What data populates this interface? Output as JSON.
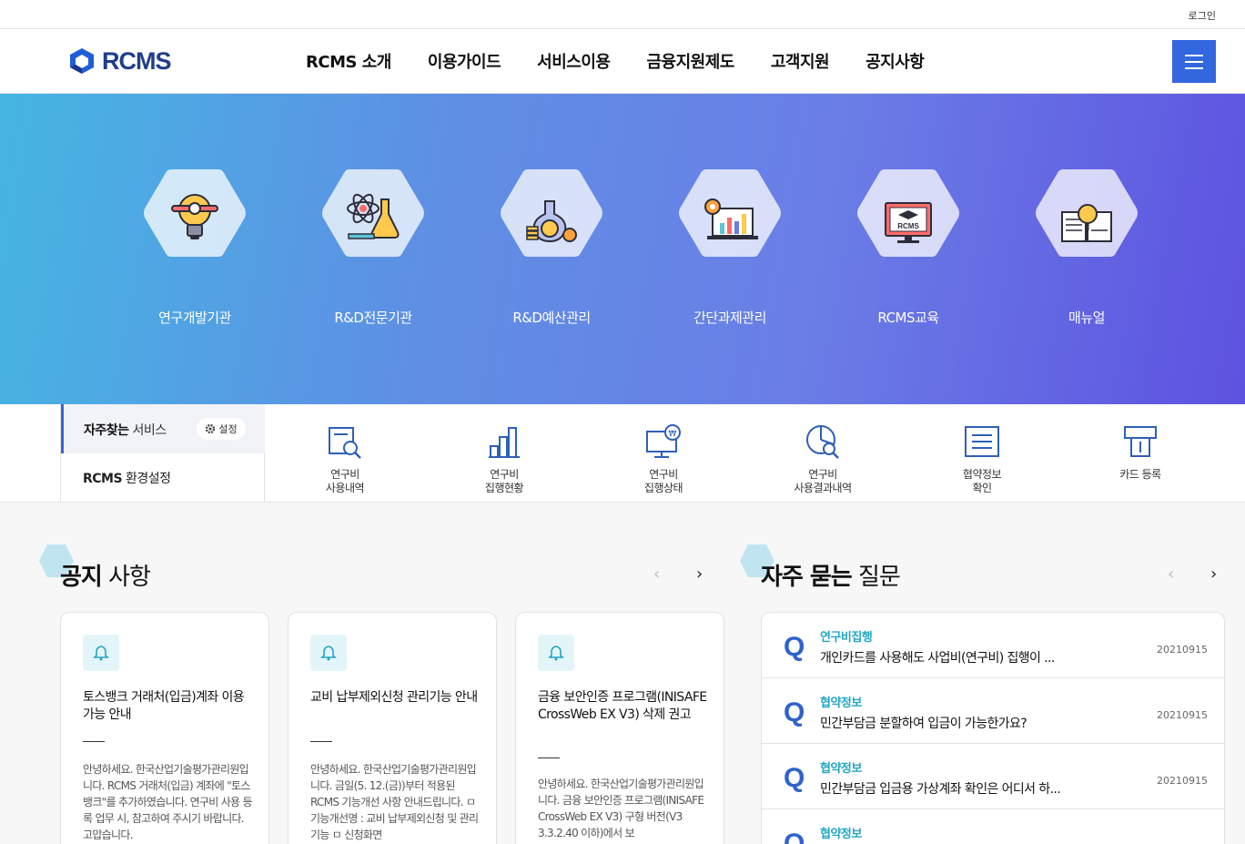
{
  "utility": {
    "login": "로그인"
  },
  "header": {
    "logo_text": "RCMS",
    "nav": [
      "RCMS 소개",
      "이용가이드",
      "서비스이용",
      "금융지원제도",
      "고객지원",
      "공지사항"
    ]
  },
  "hero": {
    "items": [
      {
        "label": "연구개발기관",
        "icon": "lightbulb-gear-icon"
      },
      {
        "label": "R&D전문기관",
        "icon": "atom-flask-icon"
      },
      {
        "label": "R&D예산관리",
        "icon": "flask-coin-icon"
      },
      {
        "label": "간단과제관리",
        "icon": "chart-monitor-icon"
      },
      {
        "label": "RCMS교육",
        "icon": "graduation-monitor-icon"
      },
      {
        "label": "매뉴얼",
        "icon": "book-magnifier-icon"
      }
    ]
  },
  "quick": {
    "tab_frequent_bold": "자주찾는",
    "tab_frequent_rest": " 서비스",
    "settings_label": "설정",
    "tab_env_bold": "RCMS",
    "tab_env_rest": " 환경설정",
    "items": [
      {
        "line1": "연구비",
        "line2": "사용내역",
        "icon": "document-search-icon"
      },
      {
        "line1": "연구비",
        "line2": "집행현황",
        "icon": "bar-chart-icon"
      },
      {
        "line1": "연구비",
        "line2": "집행상태",
        "icon": "monitor-won-icon"
      },
      {
        "line1": "연구비",
        "line2": "사용결과내역",
        "icon": "pie-search-icon"
      },
      {
        "line1": "협약정보",
        "line2": "확인",
        "icon": "list-document-icon"
      },
      {
        "line1": "카드 등록",
        "line2": "",
        "icon": "card-reader-icon"
      }
    ]
  },
  "notice": {
    "title_bold": "공지",
    "title_rest": " 사항",
    "prev": "‹",
    "next": "›",
    "cards": [
      {
        "title": "토스뱅크 거래처(입금)계좌 이용 가능 안내",
        "body": "안녕하세요. 한국산업기술평가관리원입니다. RCMS 거래처(입금) 계좌에 \"토스뱅크\"를 추가하였습니다. 연구비 사용 등록 업무 시, 참고하여 주시기 바랍니다. 고맙습니다."
      },
      {
        "title": "교비 납부제외신청 관리기능 안내",
        "body": "안녕하세요. 한국산업기술평가관리원입니다. 금일(5. 12.(금))부터 적용된 RCMS 기능개선 사항 안내드립니다. ㅁ 기능개선명 : 교비 납부제외신청 및 관리기능 ㅁ 신청화면"
      },
      {
        "title": "금융 보안인증 프로그램(INISAFE CrossWeb EX V3) 삭제 권고",
        "body": "안녕하세요. 한국산업기술평가관리원입니다. 금융 보안인증 프로그램(INISAFE CrossWeb EX V3) 구형 버전(V3 3.3.2.40 이하)에서 보"
      }
    ]
  },
  "faq": {
    "title_bold": "자주 묻는",
    "title_rest": " 질문",
    "prev": "‹",
    "next": "›",
    "q_mark": "Q",
    "items": [
      {
        "category": "연구비집행",
        "question": "개인카드를 사용해도 사업비(연구비) 집행이 ...",
        "date": "20210915"
      },
      {
        "category": "협약정보",
        "question": "민간부담금 분할하여 입금이 가능한가요?",
        "date": "20210915"
      },
      {
        "category": "협약정보",
        "question": "민간부담금 입금용 가상계좌 확인은 어디서 하...",
        "date": "20210915"
      },
      {
        "category": "협약정보",
        "question": "",
        "date": ""
      }
    ]
  },
  "colors": {
    "brand": "#1f3e8c",
    "accent": "#3267dd",
    "teal": "#24a6c4"
  }
}
